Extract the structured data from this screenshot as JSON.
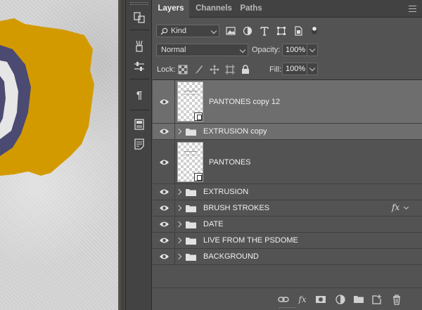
{
  "panel": {
    "tabs": [
      {
        "label": "Layers",
        "active": true
      },
      {
        "label": "Channels",
        "active": false
      },
      {
        "label": "Paths",
        "active": false
      }
    ],
    "filter": {
      "kind_label": "Kind",
      "icons": [
        "image-filter-icon",
        "adjustment-filter-icon",
        "type-filter-icon",
        "shape-filter-icon",
        "smart-object-filter-icon",
        "filter-toggle-icon"
      ]
    },
    "blend_mode": "Normal",
    "opacity_label": "Opacity:",
    "opacity_value": "100%",
    "lock_label": "Lock:",
    "fill_label": "Fill:",
    "fill_value": "100%"
  },
  "layers": [
    {
      "name": "PANTONES copy 12",
      "type": "smart-object",
      "selected": true,
      "visible": true
    },
    {
      "name": "EXTRUSION copy",
      "type": "group",
      "selected": true,
      "visible": true
    },
    {
      "name": "PANTONES",
      "type": "smart-object",
      "selected": false,
      "visible": true
    },
    {
      "name": "EXTRUSION",
      "type": "group",
      "selected": false,
      "visible": true
    },
    {
      "name": "BRUSH STROKES",
      "type": "group",
      "selected": false,
      "visible": true,
      "fx": "fx"
    },
    {
      "name": "DATE",
      "type": "group",
      "selected": false,
      "visible": true
    },
    {
      "name": "LIVE FROM THE PSDOME",
      "type": "group",
      "selected": false,
      "visible": true
    },
    {
      "name": "BACKGROUND",
      "type": "group",
      "selected": false,
      "visible": true
    }
  ],
  "bottom_bar_icons": [
    "link-layers-icon",
    "add-style-icon",
    "add-mask-icon",
    "adjustment-layer-icon",
    "new-group-icon",
    "new-layer-icon",
    "delete-layer-icon"
  ],
  "colors": {
    "canvas_yellow": "#d39a00",
    "canvas_navy": "#4a4a72",
    "panel_bg": "#535353",
    "selected_row": "#6e6e6e"
  }
}
